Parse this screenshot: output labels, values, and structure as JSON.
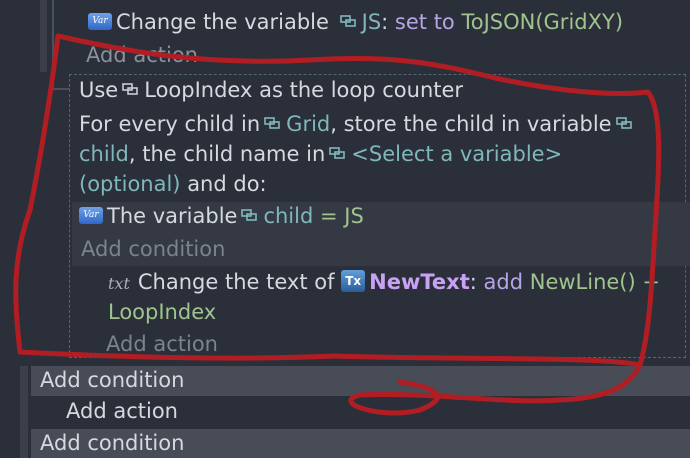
{
  "colors": {
    "background": "#2b2f39",
    "condition_band": "#3a3f4a",
    "annotation_red": "#b01e23",
    "variable_teal": "#7fb7bb",
    "keyword_purple": "#b7a4e8",
    "function_green": "#9fc48e",
    "object_purple": "#c9a1f5"
  },
  "top_action": {
    "badge": "Var",
    "prefix": "Change the variable",
    "variable": "JS",
    "colon": ":",
    "operator": "set to",
    "value": "ToJSON(GridXY)"
  },
  "add_action_1": "Add action",
  "loop": {
    "use": "Use",
    "counter_variable": "LoopIndex",
    "as_counter": "as the loop counter",
    "line1_prefix": "For every child in",
    "container_variable": "Grid",
    "line1_suffix": ", store the child in variable",
    "child_variable": "child",
    "line2_mid": ", the child name in",
    "select_placeholder": "<Select a variable>",
    "optional": "(optional)",
    "and_do": "and do:"
  },
  "condition": {
    "badge": "Var",
    "prefix": "The variable",
    "variable": "child",
    "operator": "=",
    "value": "JS"
  },
  "add_condition_inner": "Add condition",
  "text_action": {
    "icon_label": "txt",
    "prefix": "Change the text of",
    "object_badge": "Tx",
    "object": "NewText",
    "colon": ":",
    "operator": "add",
    "value_line1": "NewLine() +",
    "value_line2": "LoopIndex"
  },
  "add_action_inner": "Add action",
  "bottom": {
    "add_condition_1": "Add condition",
    "add_action": "Add action",
    "add_condition_2": "Add condition"
  }
}
